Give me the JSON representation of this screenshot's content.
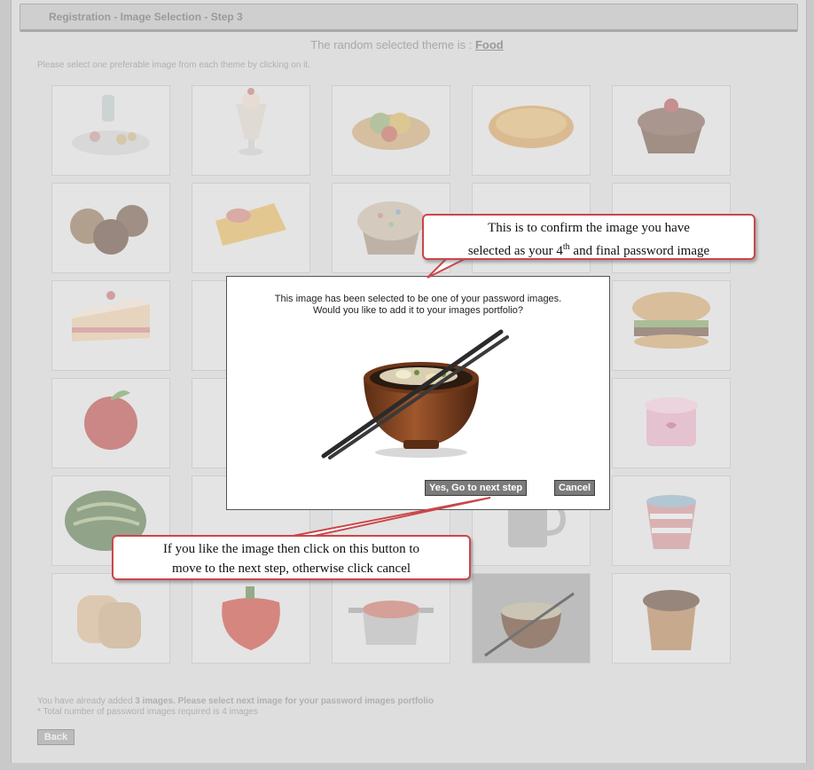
{
  "header": {
    "title": "Registration - Image Selection - Step 3"
  },
  "theme_line": {
    "prefix": "The random selected theme is :",
    "theme": "Food"
  },
  "instruction": "Please select one preferable image from each theme by clicking on it.",
  "grid": {
    "images": [
      "bottle-snacks-icon",
      "ice-cream-float-icon",
      "fruit-tart-icon",
      "pie-icon",
      "cupcake-cherry-icon",
      "chocolate-buns-icon",
      "cheese-icon",
      "sprinkle-cupcake-icon",
      "",
      "",
      "cake-slice-icon",
      "",
      "",
      "",
      "burger-icon",
      "apple-icon",
      "",
      "",
      "",
      "yogurt-icon",
      "watermelon-icon",
      "",
      "",
      "mug-icon",
      "drink-cup-icon",
      "toast-icon",
      "pepper-icon",
      "pot-icon",
      "noodle-bowl-icon",
      "wooden-cup-icon"
    ],
    "selected_index": 28
  },
  "footer": {
    "line1_prefix": "You have already added",
    "line1_bold": "3 images. Please select next image for your password images portfolio",
    "line2": "* Total number of password images required is 4 images"
  },
  "back_button": "Back",
  "modal": {
    "message_line1": "This image has been selected to be one of your password images.",
    "message_line2": "Would you like to add it to your images portfolio?",
    "image": "noodle-bowl-chopsticks-icon",
    "confirm_button": "Yes, Go to next step",
    "cancel_button": "Cancel"
  },
  "callouts": {
    "top_line1": "This is to confirm the image you have",
    "top_line2_a": "selected as your 4",
    "top_line2_sup": "th",
    "top_line2_b": " and final password image",
    "bottom_line1": "If you like the image then click on this button to",
    "bottom_line2": "move to the next step, otherwise click cancel"
  },
  "colors": {
    "callout_border": "#c9474a",
    "button": "#7b7b7b",
    "backdrop": "#dedede"
  }
}
